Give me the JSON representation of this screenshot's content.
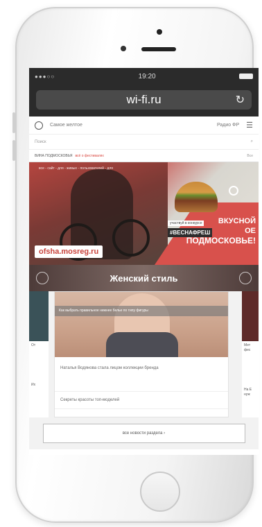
{
  "status": {
    "signal": "●●●○○",
    "time": "19:20"
  },
  "browser": {
    "url": "wi-fi.ru",
    "reload_icon": "reload-icon"
  },
  "site_header": {
    "city": "Самое желтое",
    "weather": "Радио ФР",
    "menu_icon": "☰"
  },
  "search": {
    "placeholder": "Поиск",
    "icon": "⌕"
  },
  "ticker": {
    "text": "ВИНА ПОДМОСКОВЬЯ",
    "link": "всё о фестивалях",
    "right": "Все"
  },
  "banner": {
    "tagline": "все - сайт - для - живых - пользователей - для",
    "site": "ofsha.mosreg.ru",
    "label_top": "участвуй в конкурсе",
    "hashtag": "#ВЕСНАФРЕШ",
    "line1": "ВКУСНОЙ",
    "line2": "ОЕ",
    "line3": "ПОДМОСКОВЬЕ!"
  },
  "section": {
    "title": "Женский стиль"
  },
  "cards": {
    "main_caption": "Как выбрать правильное нижнее белье по типу фигуры",
    "items": [
      "Наталья Водянова стала лицом коллекции бренда",
      "Секреты красоты топ-моделей"
    ],
    "left_texts": [
      "От",
      "Их"
    ],
    "right_texts": [
      "Мет фес",
      "На Е нуж"
    ]
  },
  "more_button": "все новости раздела"
}
